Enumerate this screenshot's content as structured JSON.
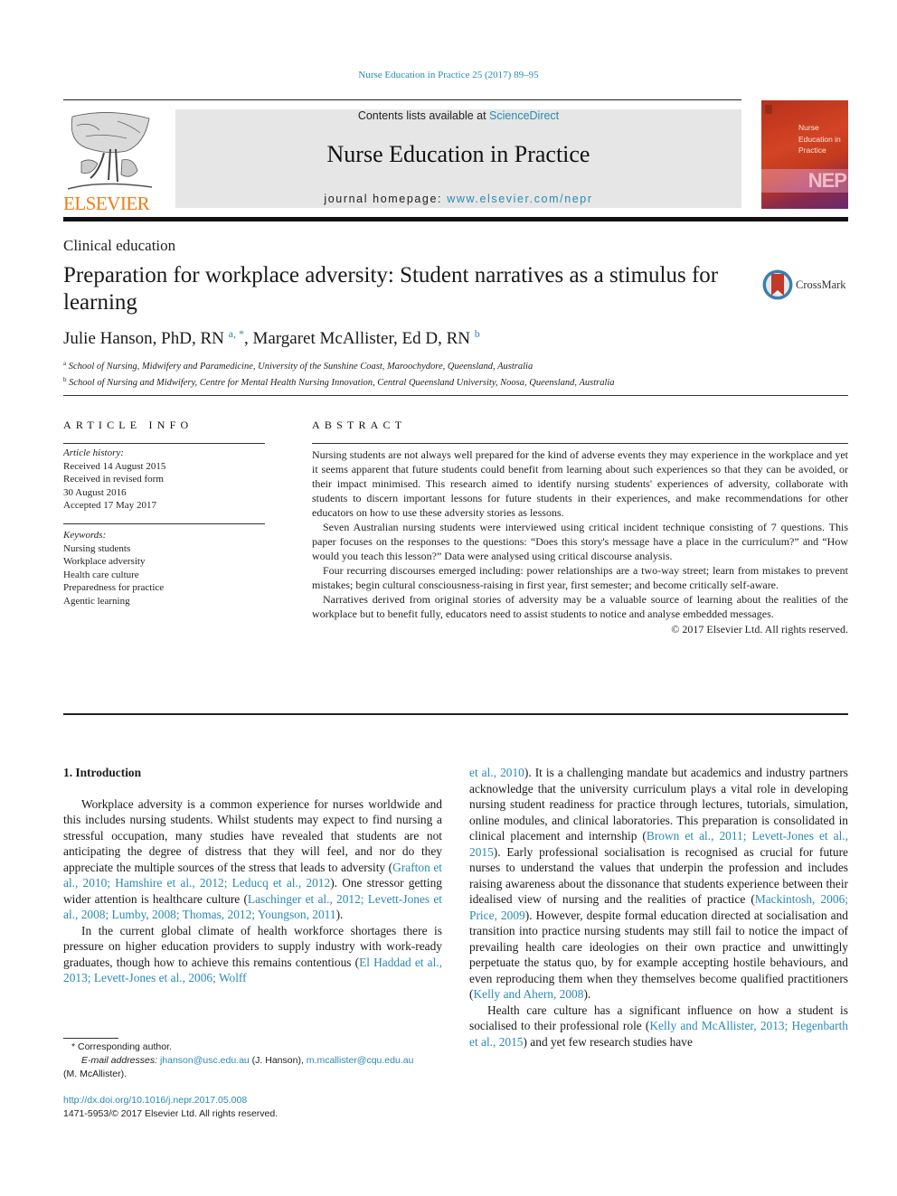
{
  "header": {
    "journal_reference": "Nurse Education in Practice 25 (2017) 89–95",
    "contents_prefix": "Contents lists available at ",
    "contents_link": "ScienceDirect",
    "journal_title": "Nurse Education in Practice",
    "homepage_prefix": "journal homepage: ",
    "homepage_link": "www.elsevier.com/nepr",
    "publisher_logo_text": "ELSEVIER",
    "cover": {
      "title_lines": [
        "Nurse",
        "Education in",
        "Practice"
      ],
      "abbrev": "NEP"
    },
    "colors": {
      "link": "#2a8ab4",
      "elsevier_orange": "#f07c14",
      "banner_bg": "#e6e6e6",
      "cover_red": "#c33a1e"
    }
  },
  "article": {
    "section": "Clinical education",
    "title": "Preparation for workplace adversity: Student narratives as a stimulus for learning",
    "crossmark_label": "CrossMark",
    "authors": [
      {
        "name": "Julie Hanson, PhD, RN",
        "marks": "a, *"
      },
      {
        "name": "Margaret McAllister, Ed D, RN",
        "marks": "b"
      }
    ],
    "author_separator": ", ",
    "affiliations": [
      {
        "mark": "a",
        "text": "School of Nursing, Midwifery and Paramedicine, University of the Sunshine Coast, Maroochydore, Queensland, Australia"
      },
      {
        "mark": "b",
        "text": "School of Nursing and Midwifery, Centre for Mental Health Nursing Innovation, Central Queensland University, Noosa, Queensland, Australia"
      }
    ]
  },
  "article_info": {
    "heading": "ARTICLE INFO",
    "history_label": "Article history:",
    "history": [
      "Received 14 August 2015",
      "Received in revised form",
      "30 August 2016",
      "Accepted 17 May 2017"
    ],
    "keywords_label": "Keywords:",
    "keywords": [
      "Nursing students",
      "Workplace adversity",
      "Health care culture",
      "Preparedness for practice",
      "Agentic learning"
    ]
  },
  "abstract": {
    "heading": "ABSTRACT",
    "paragraphs": [
      "Nursing students are not always well prepared for the kind of adverse events they may experience in the workplace and yet it seems apparent that future students could benefit from learning about such experiences so that they can be avoided, or their impact minimised. This research aimed to identify nursing students' experiences of adversity, collaborate with students to discern important lessons for future students in their experiences, and make recommendations for other educators on how to use these adversity stories as lessons.",
      "Seven Australian nursing students were interviewed using critical incident technique consisting of 7 questions. This paper focuses on the responses to the questions: “Does this story's message have a place in the curriculum?” and “How would you teach this lesson?” Data were analysed using critical discourse analysis.",
      "Four recurring discourses emerged including: power relationships are a two-way street; learn from mistakes to prevent mistakes; begin cultural consciousness-raising in first year, first semester; and become critically self-aware.",
      "Narratives derived from original stories of adversity may be a valuable source of learning about the realities of the workplace but to benefit fully, educators need to assist students to notice and analyse embedded messages."
    ],
    "copyright": "© 2017 Elsevier Ltd. All rights reserved."
  },
  "body": {
    "section_heading": "1.  Introduction",
    "p1": {
      "t1": "Workplace adversity is a common experience for nurses worldwide and this includes nursing students. Whilst students may expect to find nursing a stressful occupation, many studies have revealed that students are not anticipating the degree of distress that they will feel, and nor do they appreciate the multiple sources of the stress that leads to adversity (",
      "c1": "Grafton et al., 2010; Hamshire et al., 2012; Leducq et al., 2012",
      "t2": "). One stressor getting wider attention is healthcare culture (",
      "c2": "Laschinger et al., 2012; Levett-Jones et al., 2008; Lumby, 2008; Thomas, 2012; Youngson, 2011",
      "t3": ")."
    },
    "p2": {
      "t1": "In the current global climate of health workforce shortages there is pressure on higher education providers to supply industry with work-ready graduates, though how to achieve this remains contentious (",
      "c1a": "El Haddad et al., 2013; Levett-Jones et al., 2006; Wolff",
      "c1b": "et al., 2010",
      "t2": "). It is a challenging mandate but academics and industry partners acknowledge that the university curriculum plays a vital role in developing nursing student readiness for practice through lectures, tutorials, simulation, online modules, and clinical laboratories. This preparation is consolidated in clinical placement and internship (",
      "c2": "Brown et al., 2011; Levett-Jones et al., 2015",
      "t3": "). Early professional socialisation is recognised as crucial for future nurses to understand the values that underpin the profession and includes raising awareness about the dissonance that students experience between their idealised view of nursing and the realities of practice (",
      "c3": "Mackintosh, 2006; Price, 2009",
      "t4": "). However, despite formal education directed at socialisation and transition into practice nursing students may still fail to notice the impact of prevailing health care ideologies on their own practice and unwittingly perpetuate the status quo, by for example accepting hostile behaviours, and even reproducing them when they themselves become qualified practitioners (",
      "c4": "Kelly and Ahern, 2008",
      "t5": ")."
    },
    "p3": {
      "t1": "Health care culture has a significant influence on how a student is socialised to their professional role (",
      "c1": "Kelly and McAllister, 2013; Hegenbarth et al., 2015",
      "t2": ") and yet few research studies have"
    }
  },
  "footnotes": {
    "corresponding": "* Corresponding author.",
    "email_label": "E-mail addresses: ",
    "email1": "jhanson@usc.edu.au",
    "email1_owner": " (J. Hanson), ",
    "email2": "m.mcallister@cqu.edu.au",
    "email2_owner": "(M. McAllister).",
    "doi": "http://dx.doi.org/10.1016/j.nepr.2017.05.008",
    "issn_copyright": "1471-5953/© 2017 Elsevier Ltd. All rights reserved."
  }
}
